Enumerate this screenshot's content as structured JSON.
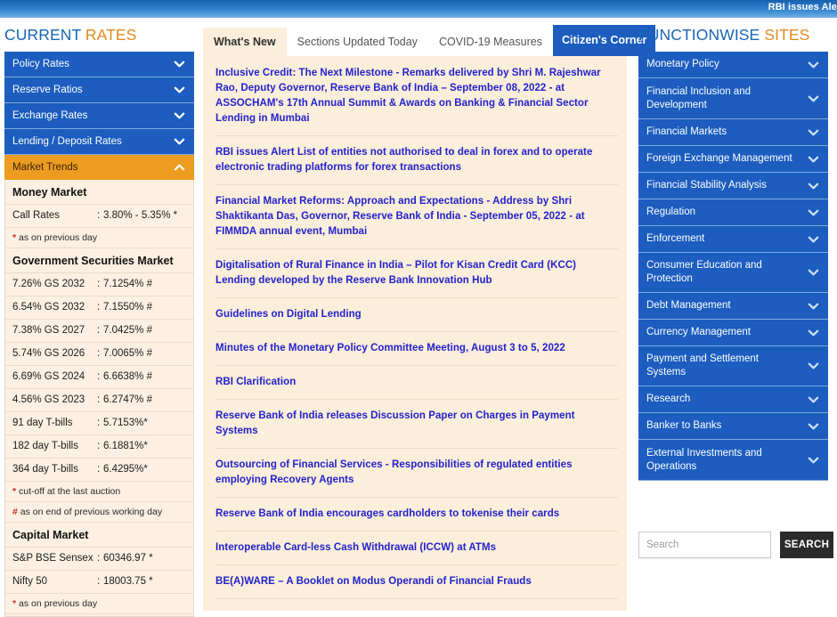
{
  "ticker": {
    "text": "RBI issues Ale"
  },
  "left": {
    "heading_part1": "CURRENT",
    "heading_part2": "RATES",
    "accordion": [
      {
        "label": "Policy  Rates",
        "icon": "chevron-down-icon",
        "state": "collapsed"
      },
      {
        "label": "Reserve  Ratios",
        "icon": "chevron-down-icon",
        "state": "collapsed"
      },
      {
        "label": "Exchange  Rates",
        "icon": "chevron-down-icon",
        "state": "collapsed"
      },
      {
        "label": "Lending / Deposit  Rates",
        "icon": "chevron-down-icon",
        "state": "collapsed"
      },
      {
        "label": "Market  Trends",
        "icon": "chevron-up-icon",
        "state": "expanded"
      }
    ],
    "market_trends": {
      "money_market_heading": "Money Market",
      "money_market_rows": [
        {
          "label": "Call Rates",
          "value": "3.80% - 5.35% *"
        }
      ],
      "money_market_note_mark": "*",
      "money_market_note": " as on previous day",
      "gsec_heading": "Government Securities Market",
      "gsec_rows": [
        {
          "label": "7.26% GS 2032",
          "value": "7.1254% #"
        },
        {
          "label": "6.54% GS 2032",
          "value": "7.1550% #"
        },
        {
          "label": "7.38% GS 2027",
          "value": "7.0425% #"
        },
        {
          "label": "5.74% GS 2026",
          "value": "7.0065% #"
        },
        {
          "label": "6.69% GS 2024",
          "value": "6.6638% #"
        },
        {
          "label": "4.56% GS 2023",
          "value": "6.2747% #"
        },
        {
          "label": "91 day T-bills",
          "value": "5.7153%*"
        },
        {
          "label": "182 day T-bills",
          "value": "6.1881%*"
        },
        {
          "label": "364 day T-bills",
          "value": "6.4295%*"
        }
      ],
      "gsec_note1_mark": "*",
      "gsec_note1": " cut-off at the last auction",
      "gsec_note2_mark": "#",
      "gsec_note2": " as on end of previous working day",
      "capital_heading": "Capital Market",
      "capital_rows": [
        {
          "label": "S&P BSE Sensex",
          "value": "60346.97 *"
        },
        {
          "label": "Nifty 50",
          "value": "18003.75 *"
        }
      ],
      "capital_note_mark": "*",
      "capital_note": " as on previous day"
    }
  },
  "center": {
    "tabs": [
      {
        "label": "What's New",
        "style": "sel"
      },
      {
        "label": "Sections Updated Today",
        "style": "plain"
      },
      {
        "label": "COVID-19 Measures",
        "style": "plain"
      },
      {
        "label": "Citizen's Corner",
        "style": "highlight"
      }
    ],
    "news": [
      "Inclusive Credit: The Next Milestone - Remarks delivered by Shri M. Rajeshwar Rao, Deputy Governor, Reserve Bank of India – September 08, 2022 - at ASSOCHAM's 17th Annual Summit & Awards on Banking & Financial Sector Lending in Mumbai",
      "RBI issues Alert List of entities not authorised to deal in forex and to operate electronic trading platforms for forex transactions",
      "Financial Market Reforms: Approach and Expectations - Address by Shri Shaktikanta Das, Governor, Reserve Bank of India - September 05, 2022 - at FIMMDA annual event, Mumbai",
      "Digitalisation of Rural Finance in India – Pilot for Kisan Credit Card (KCC) Lending developed by the Reserve Bank Innovation Hub",
      "Guidelines on Digital Lending",
      "Minutes of the Monetary Policy Committee Meeting, August 3 to 5, 2022",
      "RBI Clarification",
      "Reserve Bank of India releases Discussion Paper on Charges in Payment Systems",
      "Outsourcing of Financial Services - Responsibilities of regulated entities employing Recovery Agents",
      "Reserve Bank of India encourages cardholders to tokenise their cards",
      "Interoperable Card-less Cash Withdrawal (ICCW) at ATMs",
      "BE(A)WARE – A Booklet on Modus Operandi of Financial Frauds"
    ]
  },
  "right": {
    "heading_part1": "FUNCTIONWISE",
    "heading_part2": "SITES",
    "items": [
      {
        "label": "Monetary Policy",
        "icon": "chevron-down-icon"
      },
      {
        "label": "Financial Inclusion and Development",
        "icon": "chevron-down-icon"
      },
      {
        "label": "Financial Markets",
        "icon": "chevron-down-icon"
      },
      {
        "label": "Foreign Exchange Management",
        "icon": "chevron-down-icon"
      },
      {
        "label": "Financial Stability Analysis",
        "icon": "chevron-down-icon"
      },
      {
        "label": "Regulation",
        "icon": "chevron-down-icon"
      },
      {
        "label": "Enforcement",
        "icon": "chevron-down-icon"
      },
      {
        "label": "Consumer Education and Protection",
        "icon": "chevron-down-icon"
      },
      {
        "label": "Debt Management",
        "icon": "chevron-down-icon"
      },
      {
        "label": "Currency Management",
        "icon": "chevron-down-icon"
      },
      {
        "label": "Payment and Settlement Systems",
        "icon": "chevron-down-icon"
      },
      {
        "label": "Research",
        "icon": "chevron-down-icon"
      },
      {
        "label": "Banker to Banks",
        "icon": "chevron-down-icon"
      },
      {
        "label": "External Investments and Operations",
        "icon": "chevron-down-icon"
      }
    ],
    "search": {
      "placeholder": "Search",
      "value": "",
      "button_label": "SEARCH"
    }
  },
  "colors": {
    "brand_blue": "#1c5dbf",
    "accent_orange": "#eb9c21",
    "panel_cream": "#fbeeda",
    "link_blue": "#2222cc"
  }
}
